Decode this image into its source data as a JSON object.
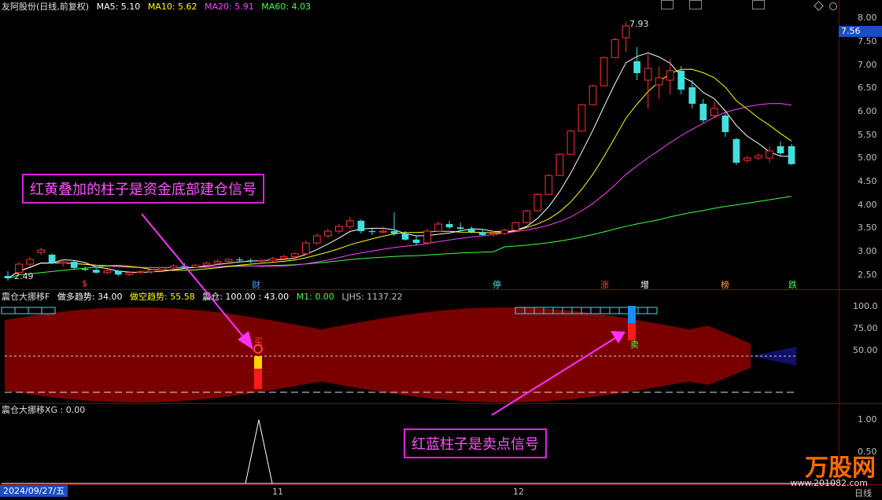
{
  "main_panel": {
    "title": "友阿股份(日线,前复权)",
    "indicators": [
      {
        "label": "MA5: 5.10",
        "color": "#ffffff"
      },
      {
        "label": "MA10: 5.62",
        "color": "#ffff00"
      },
      {
        "label": "MA20: 5.91",
        "color": "#ff40ff"
      },
      {
        "label": "MA60: 4.03",
        "color": "#40ff40"
      }
    ],
    "price_axis": [
      "8.00",
      "7.50",
      "7.00",
      "6.50",
      "6.00",
      "5.50",
      "5.00",
      "4.50",
      "4.00",
      "3.50",
      "3.00",
      "2.50"
    ],
    "current_price": "7.56",
    "high_label": "7.93",
    "low_label": "2.49",
    "events": [
      "$",
      "财",
      "停",
      "涨",
      "增",
      "榜",
      "跌"
    ]
  },
  "indicator_panel": {
    "title": "震仓大挪移F",
    "values": [
      {
        "label": "做多趋势: 34.00",
        "color": "#ffffff"
      },
      {
        "label": "做空趋势: 55.58",
        "color": "#ffff00"
      },
      {
        "label": "震仓: 100.00 : 43.00",
        "color": "#ffffff"
      },
      {
        "label": "M1: 0.00",
        "color": "#40ff40"
      },
      {
        "label": "LJHS: 1137.22",
        "color": "#c0c0c0"
      }
    ],
    "axis": [
      "100.0",
      "75.00",
      "50.00"
    ],
    "buy_label": "买",
    "sell_label": "卖"
  },
  "xg_panel": {
    "title": "震仓大挪移XG : 0.00",
    "axis": [
      "1.00",
      "0.50"
    ]
  },
  "x_axis": {
    "date_cursor": "2024/09/27/五",
    "months": [
      "11",
      "12"
    ],
    "period": "日线"
  },
  "callouts": {
    "buy_note": "红黄叠加的柱子是资金底部建仓信号",
    "sell_note": "红蓝柱子是卖点信号"
  },
  "watermark": {
    "brand": "万股网",
    "site": "www.201082.com"
  },
  "chart_data": {
    "type": "candlestick",
    "ylim": [
      2.3,
      8.1
    ],
    "candles": [
      [
        2.55,
        2.65,
        2.45,
        2.5
      ],
      [
        2.62,
        2.85,
        2.58,
        2.8
      ],
      [
        2.8,
        2.95,
        2.75,
        2.9
      ],
      [
        3.05,
        3.15,
        3.0,
        3.1
      ],
      [
        3.0,
        3.02,
        2.8,
        2.82
      ],
      [
        2.82,
        2.9,
        2.75,
        2.85
      ],
      [
        2.85,
        2.88,
        2.7,
        2.72
      ],
      [
        2.7,
        2.75,
        2.65,
        2.68
      ],
      [
        2.68,
        2.72,
        2.6,
        2.62
      ],
      [
        2.62,
        2.7,
        2.58,
        2.66
      ],
      [
        2.66,
        2.68,
        2.55,
        2.58
      ],
      [
        2.58,
        2.65,
        2.55,
        2.62
      ],
      [
        2.62,
        2.68,
        2.6,
        2.64
      ],
      [
        2.64,
        2.7,
        2.6,
        2.68
      ],
      [
        2.68,
        2.75,
        2.65,
        2.72
      ],
      [
        2.72,
        2.8,
        2.68,
        2.76
      ],
      [
        2.76,
        2.82,
        2.7,
        2.74
      ],
      [
        2.74,
        2.8,
        2.72,
        2.78
      ],
      [
        2.78,
        2.85,
        2.75,
        2.82
      ],
      [
        2.82,
        2.9,
        2.78,
        2.86
      ],
      [
        2.86,
        2.92,
        2.8,
        2.9
      ],
      [
        2.9,
        2.95,
        2.85,
        2.88
      ],
      [
        2.88,
        2.92,
        2.82,
        2.86
      ],
      [
        2.86,
        2.9,
        2.84,
        2.88
      ],
      [
        2.88,
        2.95,
        2.85,
        2.92
      ],
      [
        2.92,
        3.0,
        2.88,
        2.96
      ],
      [
        2.96,
        3.05,
        2.9,
        3.02
      ],
      [
        3.02,
        3.3,
        3.0,
        3.25
      ],
      [
        3.25,
        3.45,
        3.2,
        3.4
      ],
      [
        3.4,
        3.55,
        3.35,
        3.5
      ],
      [
        3.5,
        3.65,
        3.45,
        3.6
      ],
      [
        3.6,
        3.8,
        3.55,
        3.72
      ],
      [
        3.72,
        3.75,
        3.45,
        3.5
      ],
      [
        3.5,
        3.55,
        3.42,
        3.48
      ],
      [
        3.48,
        3.6,
        3.45,
        3.5
      ],
      [
        3.5,
        3.9,
        3.4,
        3.45
      ],
      [
        3.45,
        3.5,
        3.3,
        3.32
      ],
      [
        3.32,
        3.4,
        3.2,
        3.25
      ],
      [
        3.25,
        3.55,
        3.22,
        3.5
      ],
      [
        3.5,
        3.7,
        3.48,
        3.65
      ],
      [
        3.65,
        3.72,
        3.55,
        3.58
      ],
      [
        3.58,
        3.68,
        3.5,
        3.55
      ],
      [
        3.55,
        3.6,
        3.45,
        3.48
      ],
      [
        3.48,
        3.55,
        3.4,
        3.42
      ],
      [
        3.42,
        3.5,
        3.38,
        3.45
      ],
      [
        3.45,
        3.55,
        3.42,
        3.52
      ],
      [
        3.52,
        3.7,
        3.5,
        3.68
      ],
      [
        3.68,
        3.95,
        3.66,
        3.93
      ],
      [
        3.93,
        4.3,
        3.92,
        4.28
      ],
      [
        4.28,
        4.7,
        4.27,
        4.68
      ],
      [
        4.68,
        5.15,
        4.67,
        5.13
      ],
      [
        5.13,
        5.65,
        5.12,
        5.62
      ],
      [
        5.62,
        6.2,
        5.61,
        6.18
      ],
      [
        6.18,
        6.6,
        6.17,
        6.58
      ],
      [
        6.58,
        7.2,
        6.57,
        7.18
      ],
      [
        7.18,
        7.6,
        7.17,
        7.56
      ],
      [
        7.6,
        7.93,
        7.3,
        7.85
      ],
      [
        7.1,
        7.4,
        6.7,
        6.85
      ],
      [
        6.7,
        7.25,
        6.1,
        6.95
      ],
      [
        6.6,
        7.0,
        6.3,
        6.75
      ],
      [
        6.7,
        7.15,
        6.4,
        6.9
      ],
      [
        6.9,
        7.0,
        6.4,
        6.5
      ],
      [
        6.55,
        6.7,
        6.1,
        6.2
      ],
      [
        6.2,
        6.3,
        5.8,
        5.85
      ],
      [
        5.95,
        6.25,
        5.9,
        6.1
      ],
      [
        5.95,
        6.0,
        5.5,
        5.6
      ],
      [
        5.45,
        5.48,
        4.9,
        4.95
      ],
      [
        5.0,
        5.1,
        4.95,
        5.05
      ],
      [
        5.05,
        5.15,
        5.0,
        5.1
      ],
      [
        5.05,
        5.3,
        4.95,
        5.2
      ],
      [
        5.3,
        5.4,
        5.1,
        5.15
      ],
      [
        5.3,
        5.35,
        4.9,
        4.92
      ]
    ]
  }
}
